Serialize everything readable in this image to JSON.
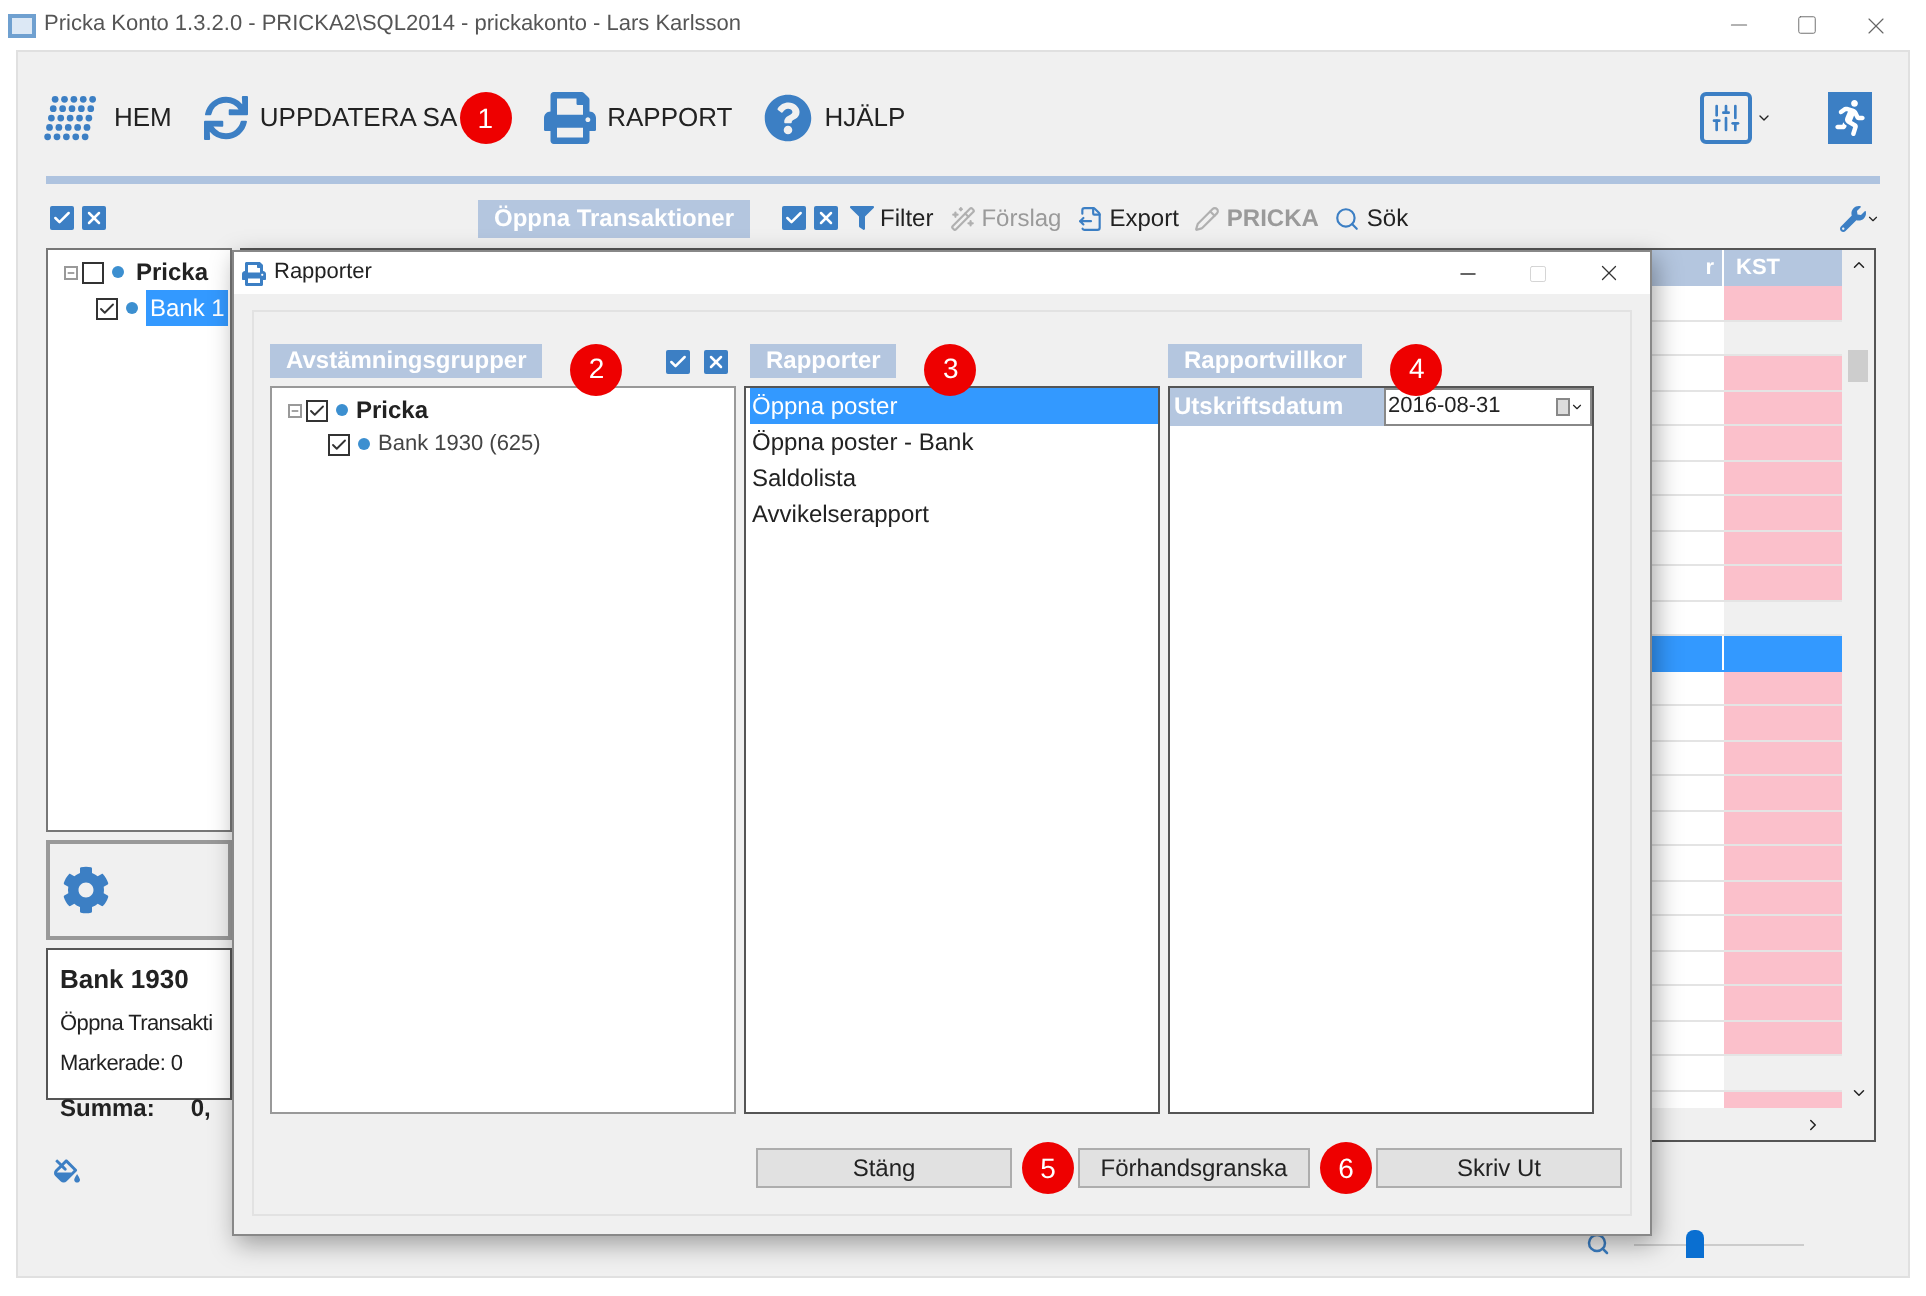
{
  "window": {
    "title": "Pricka Konto 1.3.2.0 - PRICKA2\\SQL2014 - prickakonto - Lars Karlsson"
  },
  "toolbar": [
    {
      "label": "HEM",
      "kind": "home"
    },
    {
      "label": "UPPDATERA SA",
      "kind": "refresh",
      "callout": "1"
    },
    {
      "label": "RAPPORT",
      "kind": "print"
    },
    {
      "label": "HJÄLP",
      "kind": "help"
    }
  ],
  "transactions_bar": {
    "title": "Öppna Transaktioner",
    "actions": [
      {
        "label": "Filter",
        "kind": "filter",
        "disabled": false
      },
      {
        "label": "Förslag",
        "kind": "suggest",
        "disabled": true
      },
      {
        "label": "Export",
        "kind": "export",
        "disabled": false
      },
      {
        "label": "PRICKA",
        "kind": "mark",
        "disabled": true
      },
      {
        "label": "Sök",
        "kind": "search",
        "disabled": false
      }
    ]
  },
  "tree": [
    {
      "label": "Pricka",
      "checked": false,
      "selected": false,
      "children": [
        {
          "label": "Bank 1",
          "checked": true,
          "selected": true
        }
      ]
    }
  ],
  "summary": {
    "title": "Bank 1930",
    "lines": [
      "Öppna Transakti",
      "Markerade: 0"
    ],
    "total_label": "Summa:",
    "total_value": "0,"
  },
  "grid": {
    "columns": [
      "r",
      "KST"
    ],
    "rows": [
      {
        "flagged": true,
        "selected": false
      },
      {
        "flagged": false,
        "selected": false
      },
      {
        "flagged": true,
        "selected": false
      },
      {
        "flagged": true,
        "selected": false
      },
      {
        "flagged": true,
        "selected": false
      },
      {
        "flagged": true,
        "selected": false
      },
      {
        "flagged": true,
        "selected": false
      },
      {
        "flagged": true,
        "selected": false
      },
      {
        "flagged": true,
        "selected": false
      },
      {
        "flagged": false,
        "selected": false
      },
      {
        "flagged": false,
        "selected": true
      },
      {
        "flagged": true,
        "selected": false
      },
      {
        "flagged": true,
        "selected": false
      },
      {
        "flagged": true,
        "selected": false
      },
      {
        "flagged": true,
        "selected": false
      },
      {
        "flagged": true,
        "selected": false
      },
      {
        "flagged": true,
        "selected": false
      },
      {
        "flagged": true,
        "selected": false
      },
      {
        "flagged": true,
        "selected": false
      },
      {
        "flagged": true,
        "selected": false
      },
      {
        "flagged": true,
        "selected": false
      },
      {
        "flagged": true,
        "selected": false
      },
      {
        "flagged": false,
        "selected": false
      },
      {
        "flagged": true,
        "selected": false
      }
    ]
  },
  "zoom": {
    "level": 0.35
  },
  "dialog": {
    "title": "Rapporter",
    "groups_header": {
      "label": "Avstämningsgrupper",
      "callout": "2"
    },
    "groups": [
      {
        "label": "Pricka",
        "checked": true,
        "children": [
          {
            "label": "Bank 1930 (625)",
            "checked": true
          }
        ]
      }
    ],
    "reports_header": {
      "label": "Rapporter",
      "callout": "3"
    },
    "reports": [
      {
        "label": "Öppna poster",
        "selected": true
      },
      {
        "label": "Öppna poster - Bank",
        "selected": false
      },
      {
        "label": "Saldolista",
        "selected": false
      },
      {
        "label": "Avvikelserapport",
        "selected": false
      }
    ],
    "conditions_header": {
      "label": "Rapportvillkor",
      "callout": "4"
    },
    "conditions": [
      {
        "label": "Utskriftsdatum",
        "value": "2016-08-31"
      }
    ],
    "buttons": [
      {
        "label": "Stäng"
      },
      {
        "label": "Förhandsgranska",
        "callout": "5"
      },
      {
        "label": "Skriv Ut",
        "callout": "6"
      }
    ]
  }
}
